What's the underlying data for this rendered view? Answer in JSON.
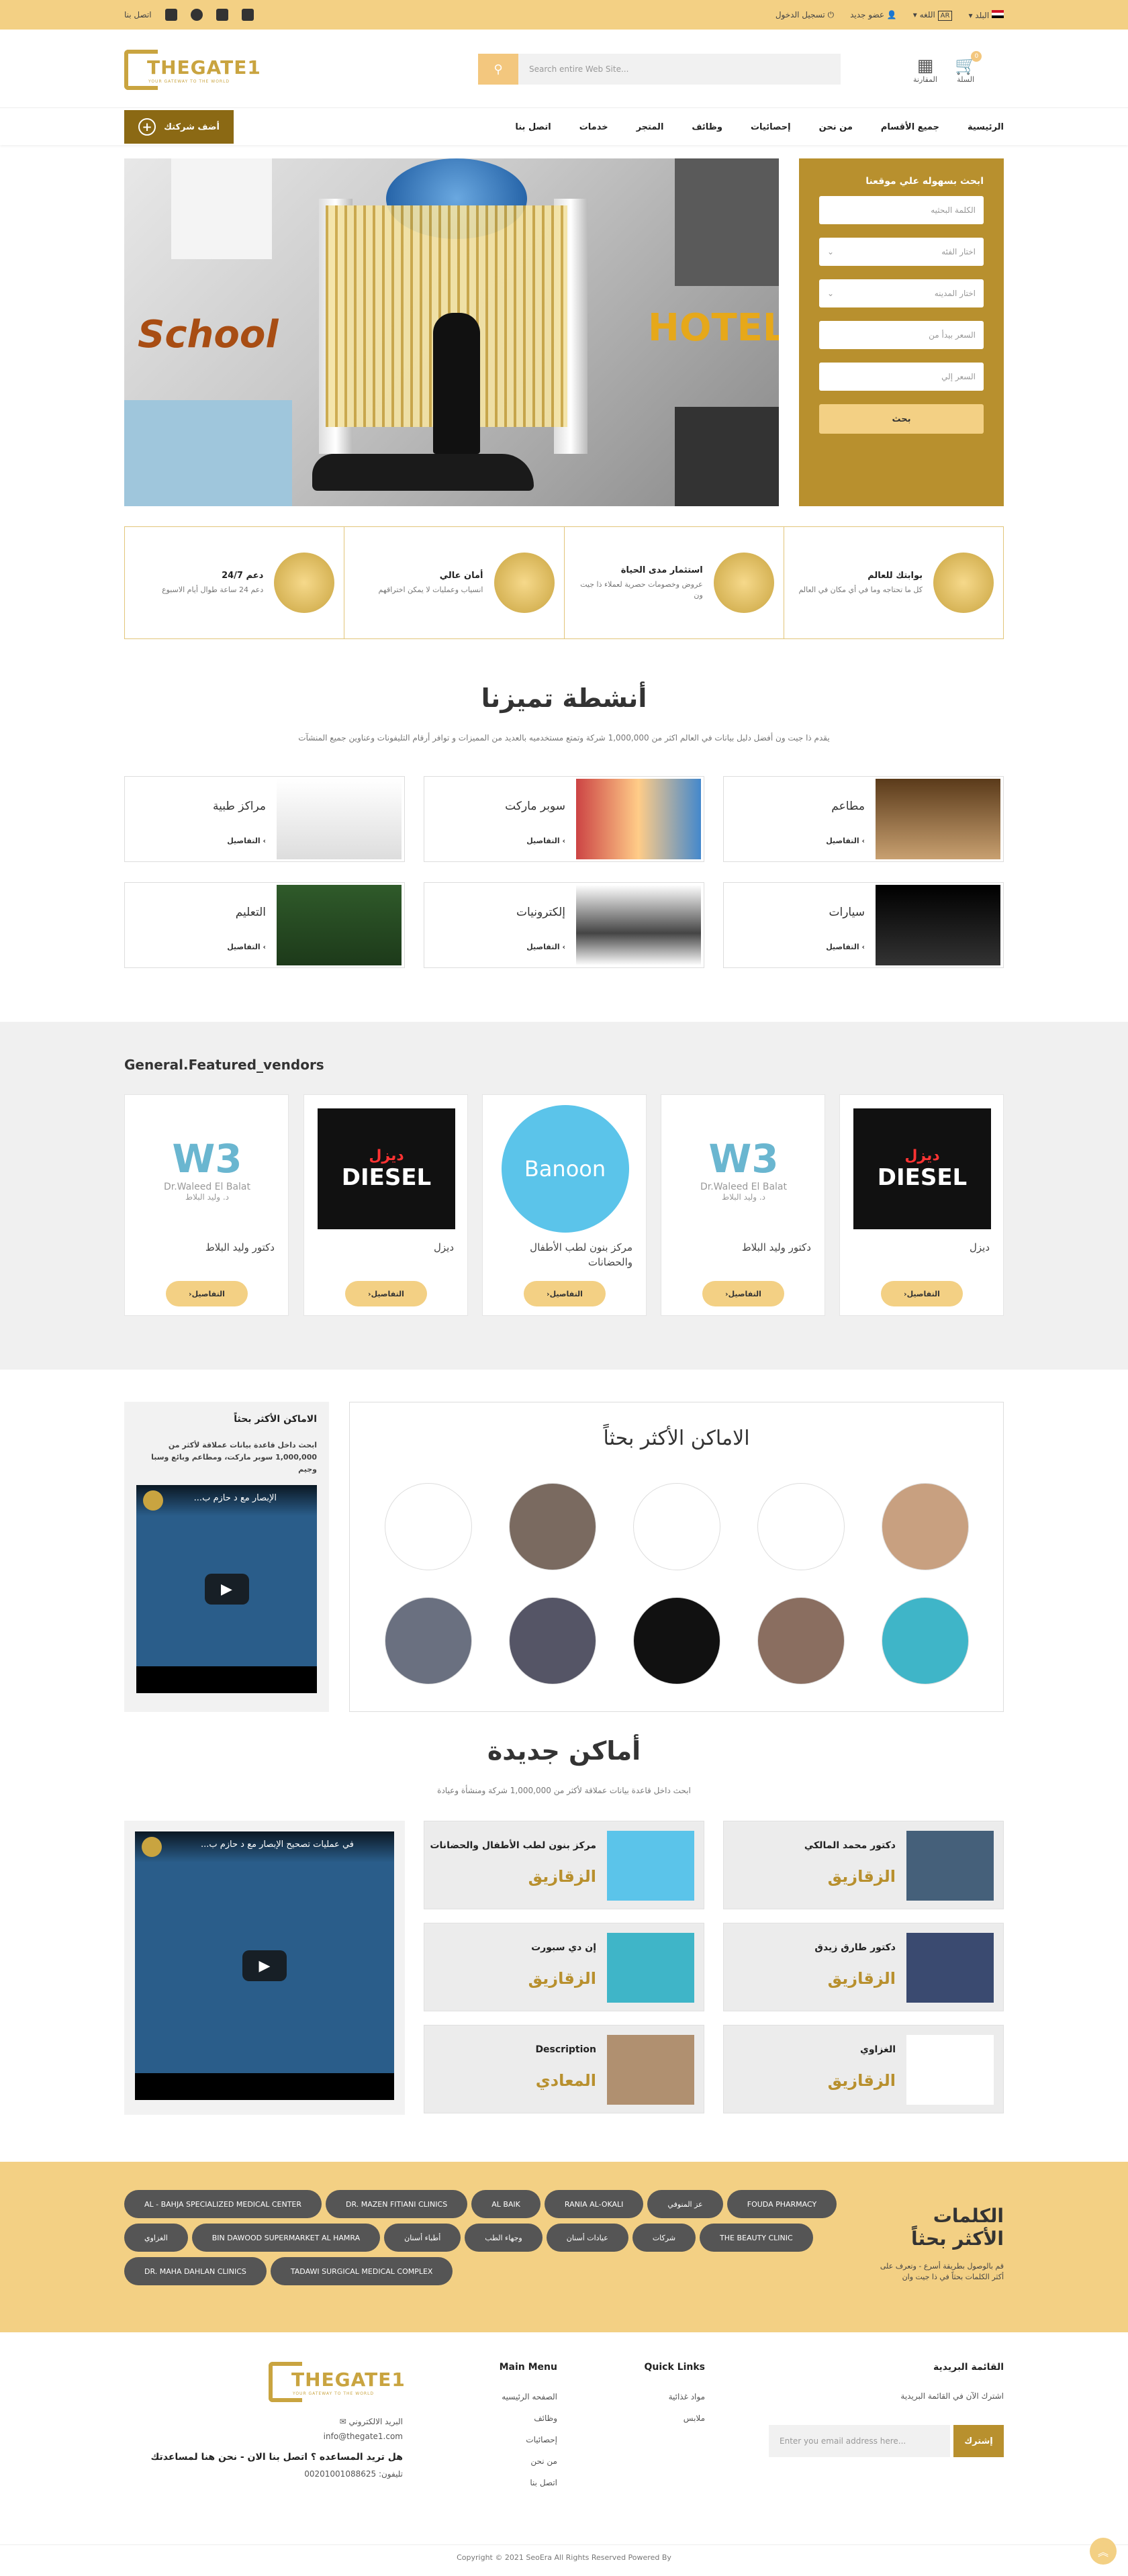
{
  "topbar": {
    "contact": "اتصل بنا",
    "country": "البلد",
    "language": "اللغه",
    "lang_code": "AR",
    "register": "عضو جديد",
    "login": "تسجيل الدخول"
  },
  "header": {
    "logo_title": "THEGATE1",
    "logo_sub": "YOUR GATEWAY TO THE WORLD",
    "search_placeholder": "Search entire Web Site...",
    "cart_label": "السلة",
    "cart_count": "0",
    "compare_label": "المقارنة"
  },
  "nav": {
    "add_company": "أضف شركتك",
    "links": [
      "الرئيسية",
      "جميع الأقسام",
      "من نحن",
      "إحصائيات",
      "وظائف",
      "المتجر",
      "خدمات",
      "اتصل بنا"
    ]
  },
  "hero": {
    "school_text": "School",
    "hotel_text": "HOTEL"
  },
  "search_panel": {
    "title": "ابحث بسهوله علي موقعنا",
    "keyword": "الكلمة البحثيه",
    "category": "اختار الفئه",
    "city": "اختار المدينه",
    "price_from": "السعر بيدأ من",
    "price_to": "السعر إلي",
    "submit": "بحث"
  },
  "features": [
    {
      "title": "بوابتك للعالم",
      "desc": "كل ما تحتاجه وما في أي مكان في العالم"
    },
    {
      "title": "استثمار مدى الحياة",
      "desc": "عروض وخصومات حصرية لعملاء ذا جيت ون"
    },
    {
      "title": "أمان عالي",
      "desc": "انسياب وعمليات لا يمكن اختراقهم"
    },
    {
      "title": "دعم 24/7",
      "desc": "دعم 24 ساعة طوال أيام الاسبوع"
    }
  ],
  "activities": {
    "title": "أنشطة تميزنا",
    "subtitle": "يقدم ذا جيت ون أفضل دليل بيانات في العالم اكثر من 1,000,000 شركة وتمتع مستخدميه بالعديد من المميزات و توافر أرقام التليفونات وعناوين جميع المنشآت",
    "details": "التفاصيل",
    "items": [
      "مطاعم",
      "سوبر ماركت",
      "مراكز طبية",
      "سيارات",
      "إلكترونيات",
      "التعليم"
    ]
  },
  "vendors": {
    "title": "General.Featured_vendors",
    "details": "التفاصيل",
    "items": [
      "ديزل",
      "دكتور وليد البلاط",
      "مركز بنون لطب الأطفال والحضانات",
      "ديزل",
      "دكتور وليد البلاط"
    ],
    "w3_name": "Dr.Waleed El Balat",
    "w3_arabic": "د. وليد البلاط",
    "diesel_logo": "DIESEL",
    "diesel_ar": "ديزل",
    "banoon_logo": "Banoon"
  },
  "most_searched": {
    "side_title": "الاماكن الأكثر بحثاً",
    "side_desc": "ابحث داخل قاعدة بيانات عملاقة لأكثر من 1,000,000 سوبر ماركت، ومطاعم وبائع وسبا وجيم",
    "title": "الاماكن الأكثر بحثاً",
    "video_title": "الإبصار مع د حازم ب..."
  },
  "new_places": {
    "title": "أماكن جديدة",
    "subtitle": "ابحث داخل قاعدة بيانات عملاقة لأكثر من 1,000,000 شركة ومنشأة وعيادة",
    "video_title": "في عمليات تصحيح الإبصار مع د حازم ب...",
    "items": [
      {
        "name": "دكتور محمد المالكي",
        "city": "الزقازيق"
      },
      {
        "name": "مركز بنون لطب الأطفال والحضانات",
        "city": "الزقازيق"
      },
      {
        "name": "دكتور طارق زيدق",
        "city": "الزقازيق"
      },
      {
        "name": "إن دي سبورت",
        "city": "الزقازيق"
      },
      {
        "name": "الغزاوي",
        "city": "الزقازيق"
      },
      {
        "name": "Description",
        "city": "المعادي"
      }
    ]
  },
  "keywords": {
    "title": "الكلمات الأكثر بحثاً",
    "desc": "قم بالوصول بطريقة أسرع - وتعرف على أكثر الكلمات بحثاً في ذا جيت وان",
    "tags": [
      "AL - BAHJA SPECIALIZED MEDICAL CENTER",
      "DR. MAZEN FITIANI CLINICS",
      "AL BAIK",
      "RANIA AL-OKALI",
      "عز المنوفي",
      "FOUDA PHARMACY",
      "الغزاوي",
      "BIN DAWOOD SUPERMARKET AL HAMRA",
      "أطباء أسنان",
      "وجهاء الطب",
      "عيادات أسنان",
      "شركات",
      "THE BEAUTY CLINIC",
      "DR. MAHA DAHLAN CLINICS",
      "TADAWI SURGICAL MEDICAL COMPLEX"
    ]
  },
  "footer": {
    "newsletter_title": "القائمة البريدية",
    "newsletter_desc": "اشترك الآن في القائمة البريدية",
    "email_placeholder": "Enter you email address here...",
    "subscribe": "إشترك",
    "quick_links_title": "Quick Links",
    "quick_links": [
      "مواد غذائية",
      "ملابس"
    ],
    "main_menu_title": "Main Menu",
    "main_menu": [
      "الصفحه الرئيسيه",
      "وظائف",
      "إحصائيات",
      "من نحن",
      "اتصل بنا"
    ],
    "email_label": "البريد الالكتروني",
    "email": "info@thegate1.com",
    "help": "هل تريد المساعده ؟ اتصل بنا الان - نحن هنا لمساعدتك",
    "phone": "تليفون: 00201001088625",
    "copyright": "Copyright © 2021 SeoEra All Rights Reserved Powered By"
  }
}
